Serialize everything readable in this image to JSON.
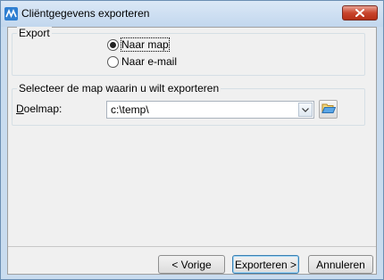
{
  "window": {
    "title": "Cliëntgegevens exporteren"
  },
  "export_group": {
    "legend": "Export",
    "options": [
      {
        "label": "Naar map",
        "selected": true
      },
      {
        "label": "Naar e-mail",
        "selected": false
      }
    ]
  },
  "folder_group": {
    "legend": "Selecteer de map waarin u wilt exporteren",
    "field_label_accesskey": "D",
    "field_label_rest": "oelmap:",
    "value": "c:\\temp\\"
  },
  "buttons": {
    "prev": "< Vorige",
    "export": "Exporteren >",
    "cancel": "Annuleren"
  },
  "icons": {
    "app": "app-wave-icon",
    "close": "close-icon",
    "dropdown": "chevron-down-icon",
    "browse": "folder-open-icon"
  },
  "colors": {
    "titlebar": "#c9dcef",
    "close_button": "#c9452d",
    "default_button_border": "#3c7fb1"
  }
}
